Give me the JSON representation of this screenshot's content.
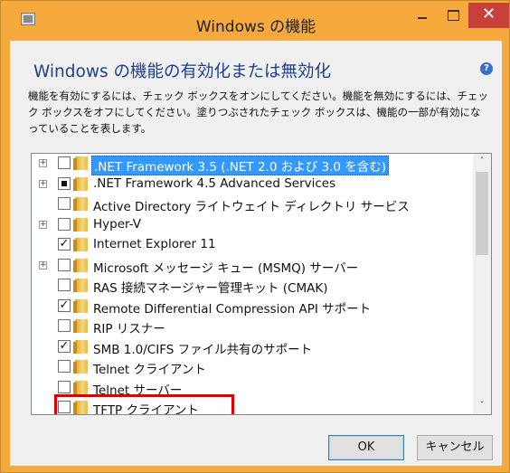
{
  "window": {
    "title": "Windows の機能",
    "minimize_glyph": "_",
    "close_glyph": "✕"
  },
  "main": {
    "heading": "Windows の機能の有効化または無効化",
    "help_glyph": "?",
    "description": "機能を有効にするには、チェック ボックスをオンにしてください。機能を無効にするには、チェック ボックスをオフにしてください。塗りつぶされたチェック ボックスは、機能の一部が有効になっていることを表します。"
  },
  "features": [
    {
      "label": ".NET Framework 3.5 (.NET 2.0 および 3.0 を含む)",
      "expandable": true,
      "state": "unchecked",
      "selected": true
    },
    {
      "label": ".NET Framework 4.5 Advanced Services",
      "expandable": true,
      "state": "partial",
      "selected": false
    },
    {
      "label": "Active Directory ライトウェイト ディレクトリ サービス",
      "expandable": false,
      "state": "unchecked",
      "selected": false
    },
    {
      "label": "Hyper-V",
      "expandable": true,
      "state": "unchecked",
      "selected": false
    },
    {
      "label": "Internet Explorer 11",
      "expandable": false,
      "state": "checked",
      "selected": false
    },
    {
      "label": "Microsoft メッセージ キュー (MSMQ) サーバー",
      "expandable": true,
      "state": "unchecked",
      "selected": false
    },
    {
      "label": "RAS 接続マネージャー管理キット (CMAK)",
      "expandable": false,
      "state": "unchecked",
      "selected": false
    },
    {
      "label": "Remote Differential Compression API サポート",
      "expandable": false,
      "state": "checked",
      "selected": false
    },
    {
      "label": "RIP リスナー",
      "expandable": false,
      "state": "unchecked",
      "selected": false
    },
    {
      "label": "SMB 1.0/CIFS ファイル共有のサポート",
      "expandable": false,
      "state": "checked",
      "selected": false
    },
    {
      "label": "Telnet クライアント",
      "expandable": false,
      "state": "unchecked",
      "selected": false,
      "highlighted": true
    },
    {
      "label": "Telnet サーバー",
      "expandable": false,
      "state": "unchecked",
      "selected": false
    },
    {
      "label": "TFTP クライアント",
      "expandable": false,
      "state": "unchecked",
      "selected": false
    }
  ],
  "scrollbar": {
    "up_glyph": "˄",
    "down_glyph": "˅"
  },
  "buttons": {
    "ok": "OK",
    "cancel": "キャンセル"
  },
  "colors": {
    "accent": "#f6a93d",
    "close": "#c7413a",
    "heading": "#1b3f8f",
    "selection": "#3399ff",
    "highlight": "#e00000"
  }
}
